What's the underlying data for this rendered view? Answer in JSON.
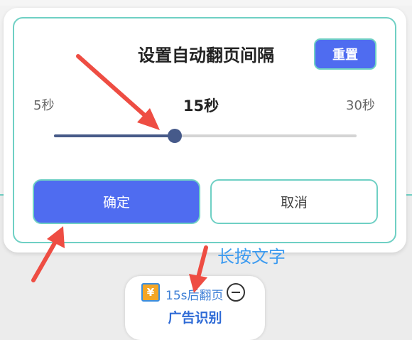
{
  "dialog": {
    "title": "设置自动翻页间隔",
    "reset_label": "重置",
    "slider": {
      "min_label": "5秒",
      "max_label": "30秒",
      "current_label": "15秒",
      "min": 5,
      "max": 30,
      "value": 15
    },
    "confirm_label": "确定",
    "cancel_label": "取消"
  },
  "annotation": {
    "hint_text": "长按文字",
    "arrow_color": "#ee4d43"
  },
  "ad_card": {
    "coin_icon": "coin-icon",
    "coin_symbol": "¥",
    "timer_text": "15s后翻页",
    "label": "广告识别"
  },
  "colors": {
    "accent": "#4f6cf0",
    "highlight": "#6fd0c4",
    "slider_fill": "#475a88",
    "hint": "#3d9bf0"
  }
}
